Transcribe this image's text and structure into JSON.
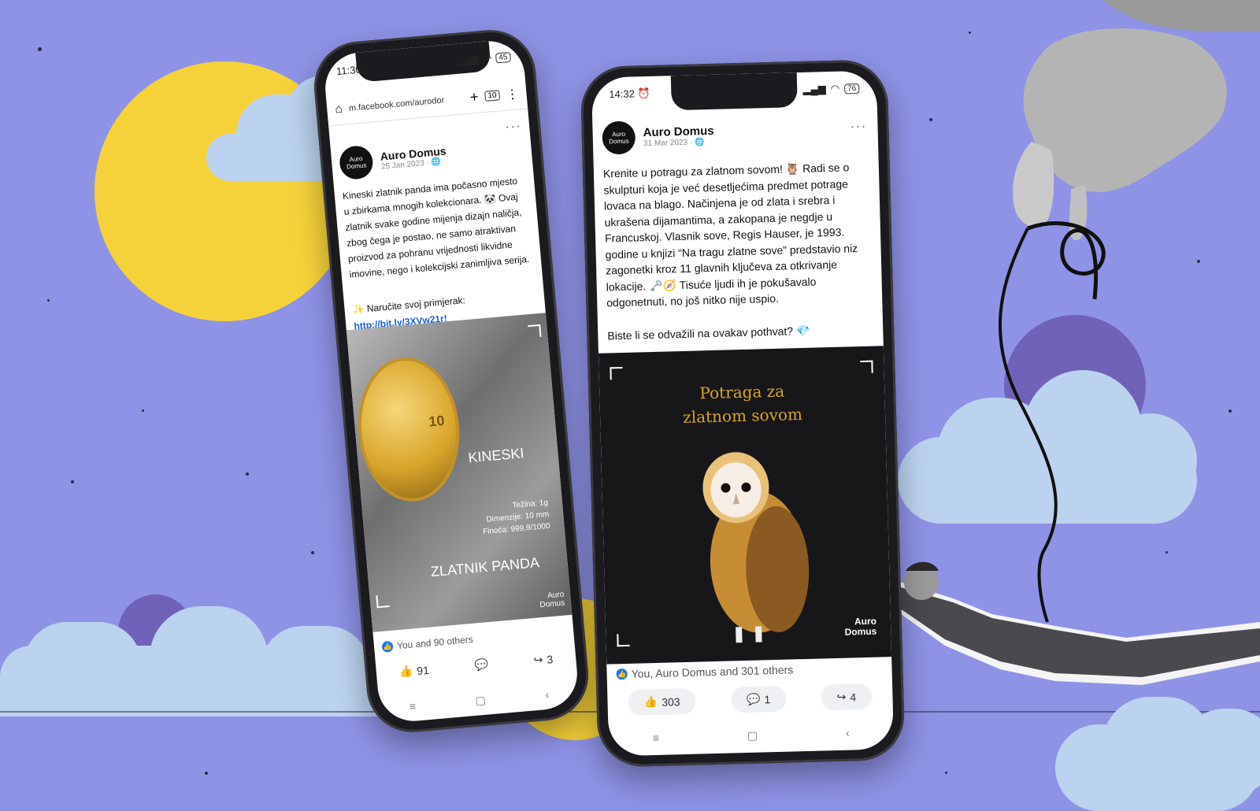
{
  "phone_left": {
    "status_time": "11:30",
    "status_battery": "45",
    "url": "m.facebook.com/aurodor",
    "tab_count": "10",
    "page_name": "Auro Domus",
    "avatar_text": "Auro Domus",
    "date": "25 Jan 2023",
    "post_text": "Kineski zlatnik panda ima počasno mjesto u zbirkama mnogih kolekcionara. 🐼 Ovaj zlatnik svake godine mijenja dizajn naličja, zbog čega je postao, ne samo atraktivan proizvod za pohranu vrijednosti likvidne imovine, nego i kolekcijski zanimljiva serija.",
    "order_text": "✨ Naručite svoj primjerak: ",
    "order_link": "http://bit.ly/3XVw21r!",
    "image": {
      "title_top": "KINESKI",
      "title_bottom": "ZLATNIK PANDA",
      "spec_weight": "Težina: 1g",
      "spec_dimensions": "Dimenzije: 10 mm",
      "spec_fineness": "Finoća: 999,9/1000",
      "coin_value": "10",
      "brand": "Auro Domus"
    },
    "reactions": "You and 90 others",
    "like_count": "91",
    "share_count": "3"
  },
  "phone_right": {
    "status_time": "14:32",
    "status_battery": "76",
    "page_name": "Auro Domus",
    "avatar_text": "Auro Domus",
    "date": "31 Mar 2023",
    "post_text": "Krenite u potragu za zlatnom sovom! 🦉 Radi se o skulpturi koja je već desetljećima predmet potrage lovaca na blago. Načinjena je od zlata i srebra i ukrašena dijamantima, a zakopana je negdje u Francuskoj. Vlasnik sove, Regis Hauser, je 1993. godine u knjizi “Na tragu zlatne sove” predstavio niz zagonetki kroz 11 glavnih ključeva za otkrivanje lokacije. 🗝️🧭 Tisuće ljudi ih je pokušavalo odgonetnuti, no još nitko nije uspio.",
    "post_question": "Biste li se odvažili na ovakav pothvat? 💎",
    "image": {
      "title_line1": "Potraga za",
      "title_line2": "zlatnom sovom",
      "brand": "Auro Domus"
    },
    "reactions": "You, Auro Domus and 301 others",
    "like_count": "303",
    "comment_count": "1",
    "share_count": "4"
  },
  "icons": [
    "home-icon",
    "plus-icon",
    "tabs-icon",
    "more-icon",
    "like-icon",
    "comment-icon",
    "share-icon",
    "globe-icon",
    "wifi-icon",
    "signal-icon",
    "alarm-icon"
  ],
  "colors": {
    "background": "#8f93e6",
    "sun": "#f6d23a",
    "cloud": "#bcd3ef",
    "facebook_blue": "#1877f2",
    "gold": "#d9a52a"
  }
}
